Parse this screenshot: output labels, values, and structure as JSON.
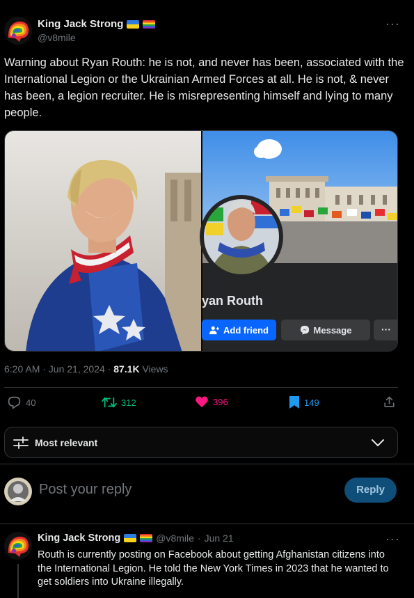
{
  "tweet": {
    "author_name": "King Jack Strong",
    "author_handle": "@v8mile",
    "text": "Warning about Ryan Routh: he is not, and never has been, associated with the International Legion or the Ukrainian Armed Forces at all. He is not, & never has been, a legion recruiter. He is misrepresenting himself and lying to many people.",
    "timestamp": "6:20 AM · Jun 21, 2024 · ",
    "views_count": "87.1K",
    "views_label": " Views",
    "more_glyph": "···"
  },
  "media": {
    "profile_name": "yan Routh",
    "add_friend_label": "Add friend",
    "message_label": "Message",
    "more_glyph": "···"
  },
  "actions": {
    "replies": "40",
    "reposts": "312",
    "likes": "396",
    "bookmarks": "149"
  },
  "sort": {
    "label": "Most relevant"
  },
  "reply_composer": {
    "placeholder": "Post your reply",
    "button_label": "Reply"
  },
  "reply_tweet": {
    "author_name": "King Jack Strong",
    "author_handle": "@v8mile",
    "separator": "·",
    "date": "Jun 21",
    "text": "Routh is currently posting on Facebook about getting Afghanistan citizens into the International Legion. He told the New York Times in 2023 that he wanted to get soldiers into Ukraine illegally.",
    "more_glyph": "···"
  },
  "colors": {
    "background": "#000000",
    "text": "#e7e9ea",
    "muted": "#71767b",
    "repost": "#00ba7c",
    "like": "#f91880",
    "bookmark": "#1d9bf0",
    "facebook_blue": "#0866ff"
  },
  "icons": {
    "reply": "speech-bubble-icon",
    "repost": "repost-arrows-icon",
    "like": "heart-icon",
    "bookmark": "bookmark-icon",
    "share": "share-upload-icon",
    "sort": "sliders-icon",
    "chevron": "chevron-down-icon"
  }
}
